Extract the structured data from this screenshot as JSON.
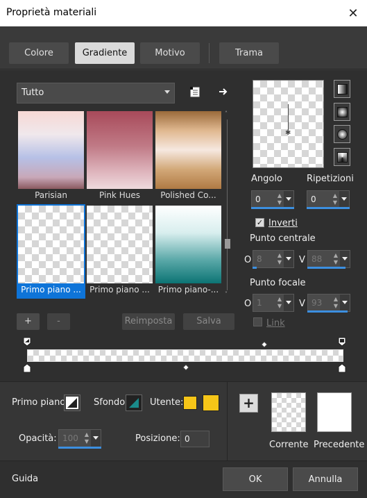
{
  "window": {
    "title": "Proprietà materiali",
    "close_icon": "close-icon"
  },
  "tabs": [
    {
      "label": "Colore",
      "active": false
    },
    {
      "label": "Gradiente",
      "active": true
    },
    {
      "label": "Motivo",
      "active": false
    },
    {
      "label": "Trama",
      "active": false
    }
  ],
  "category": {
    "selected": "Tutto"
  },
  "gradients": [
    {
      "label": "Parisian",
      "selected": false
    },
    {
      "label": "Pink Hues",
      "selected": false
    },
    {
      "label": "Polished Co...",
      "selected": false
    },
    {
      "label": "Primo piano ...",
      "selected": true
    },
    {
      "label": "Primo piano ...",
      "selected": false
    },
    {
      "label": "Primo piano-...",
      "selected": false
    }
  ],
  "gradient_buttons": {
    "add": "+",
    "remove": "-",
    "reset": "Reimposta",
    "save": "Salva"
  },
  "angle": {
    "label": "Angolo",
    "value": "0"
  },
  "repeats": {
    "label": "Ripetizioni",
    "value": "0"
  },
  "invert": {
    "label": "Inverti",
    "checked": true
  },
  "center": {
    "label": "Punto centrale",
    "o_label": "O",
    "v_label": "V",
    "o_value": "8",
    "v_value": "88"
  },
  "focal": {
    "label": "Punto focale",
    "o_label": "O",
    "v_label": "V",
    "o_value": "1",
    "v_value": "93",
    "link_label": "Link"
  },
  "bottom": {
    "foreground_label": "Primo piano:",
    "background_label": "Sfondo:",
    "user_label": "Utente:",
    "opacity_label": "Opacità:",
    "opacity_value": "100",
    "position_label": "Posizione:",
    "position_value": "0",
    "current_label": "Corrente",
    "previous_label": "Precedente",
    "user_color": "#f5c518",
    "background_color": "#1a8a8a"
  },
  "footer": {
    "help": "Guida",
    "ok": "OK",
    "cancel": "Annulla"
  },
  "colors": {
    "accent": "#3c8fe0",
    "selection": "#0e74d8"
  }
}
